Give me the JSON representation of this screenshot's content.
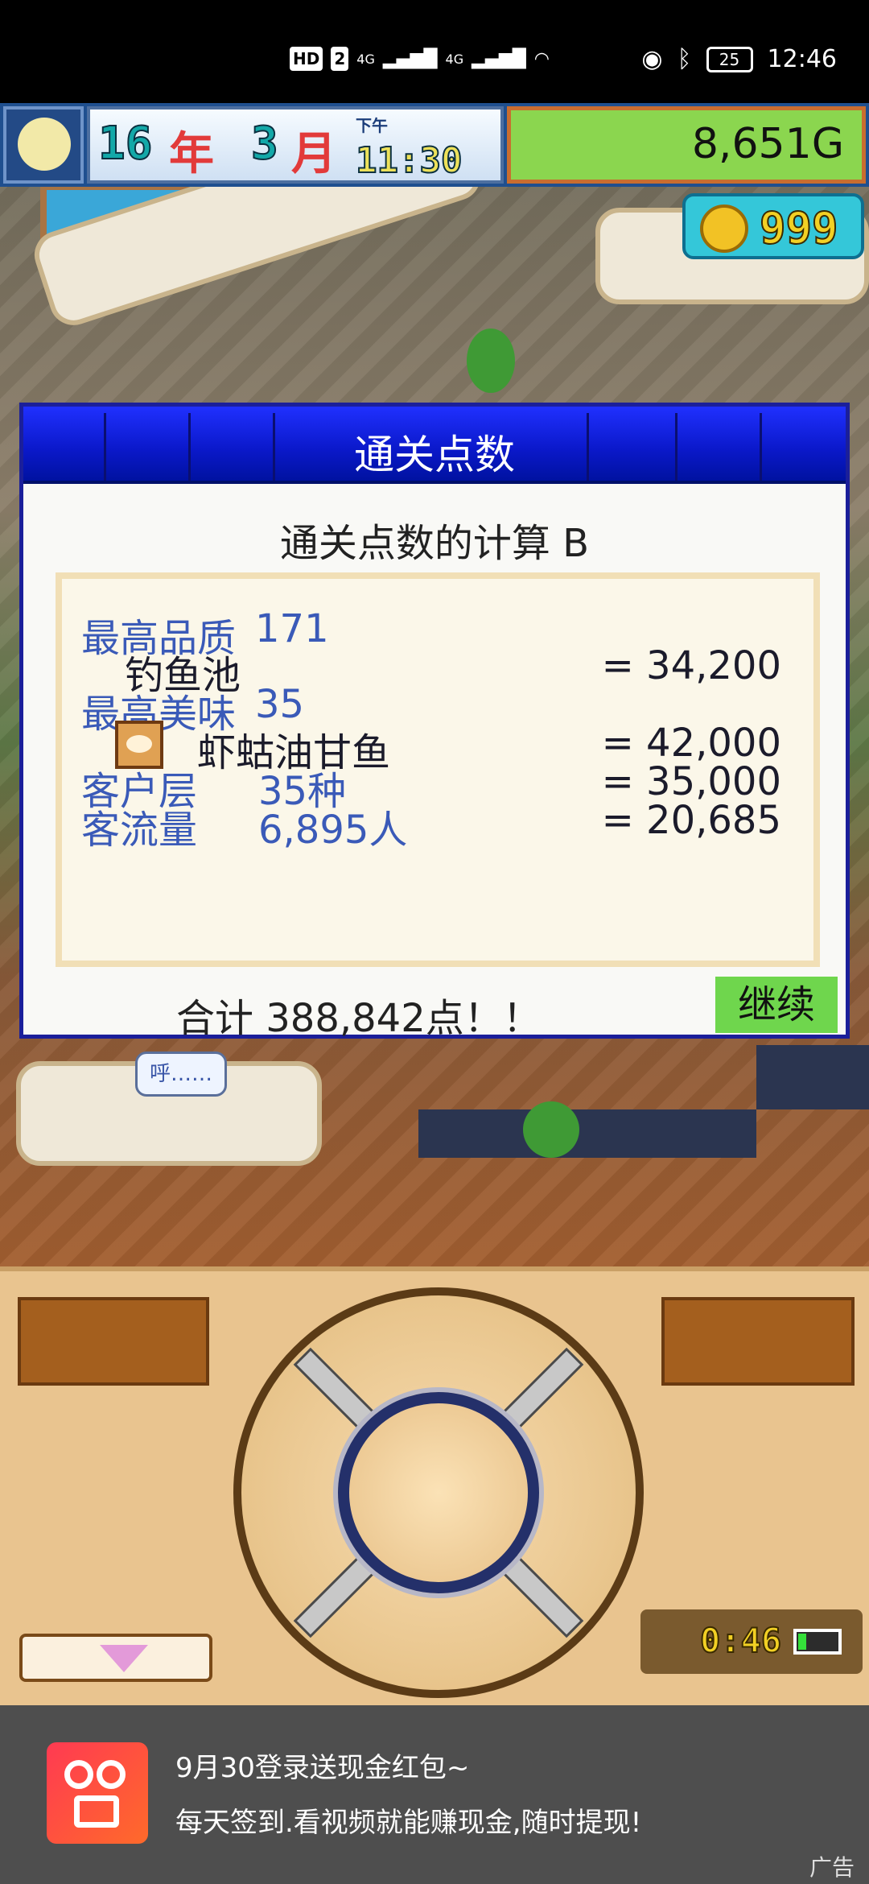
{
  "status_bar": {
    "hd_label": "HD",
    "sim1": "2",
    "signal1": "4G",
    "signal2": "4G",
    "battery": "25",
    "time": "12:46"
  },
  "hud": {
    "year": "16",
    "year_unit": "年",
    "month": "3",
    "month_unit": "月",
    "period": "下午",
    "time": "11:30",
    "money": "8,651G",
    "coins": "999"
  },
  "dialog": {
    "title": "通关点数",
    "subtitle": "通关点数的计算 B",
    "rows": [
      {
        "label": "最高品质",
        "value": "171"
      },
      {
        "item": "钓鱼池",
        "score": "= 34,200"
      },
      {
        "label": "最高美味",
        "value": "35"
      },
      {
        "item": "虾蛄油甘鱼",
        "score": "= 42,000",
        "icon": "dish-icon"
      },
      {
        "label": "客户层",
        "value": "35种",
        "score": "= 35,000"
      },
      {
        "label": "客流量",
        "value": "6,895人",
        "score": "= 20,685"
      }
    ],
    "total": "合计 388,842点！！",
    "continue_label": "继续"
  },
  "speech_bubble": "呼……",
  "controller": {
    "timer": "0:46",
    "battery_level": 0.2
  },
  "ad": {
    "line1": "9月30登录送现金红包~",
    "line2": "每天签到.看视频就能赚现金,随时提现!",
    "tag": "广告"
  }
}
